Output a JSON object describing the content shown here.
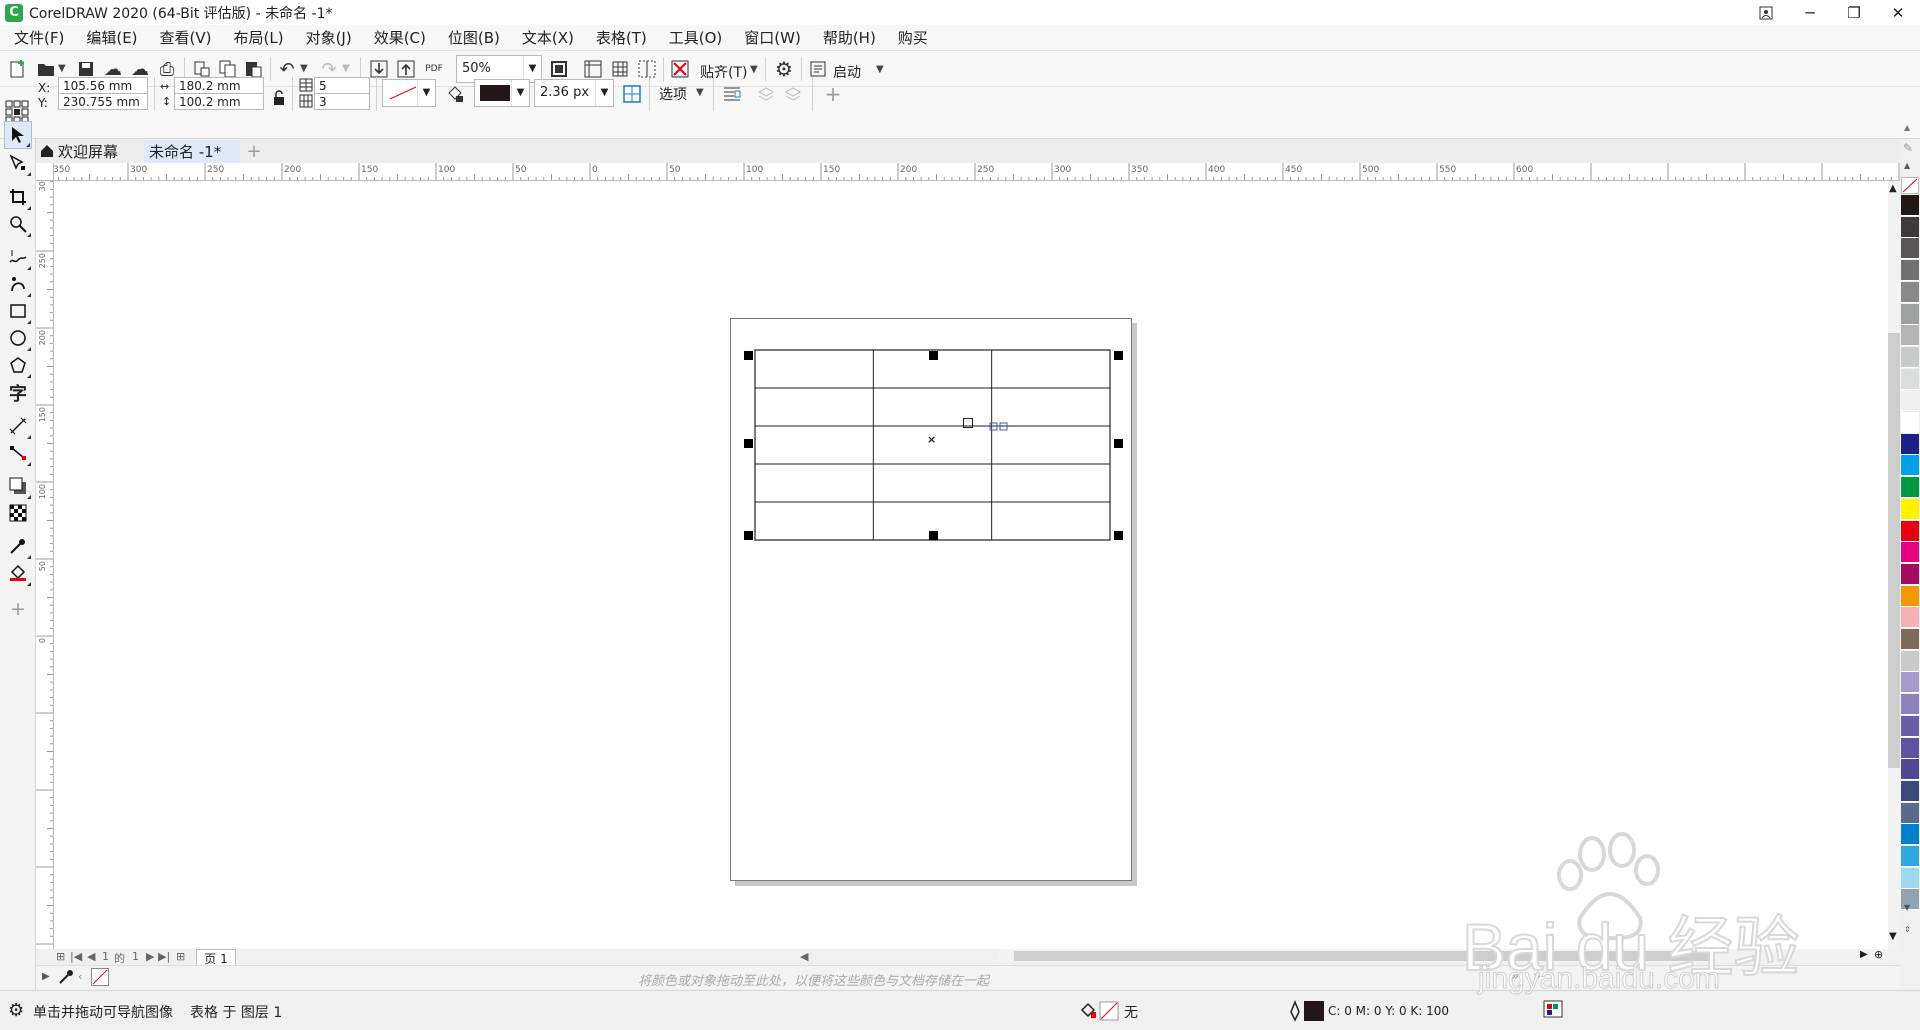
{
  "window": {
    "title": "CorelDRAW 2020 (64-Bit 评估版) - 未命名 -1*",
    "logo_letter": "C"
  },
  "menu": [
    "文件(F)",
    "编辑(E)",
    "查看(V)",
    "布局(L)",
    "对象(J)",
    "效果(C)",
    "位图(B)",
    "文本(X)",
    "表格(T)",
    "工具(O)",
    "窗口(W)",
    "帮助(H)",
    "购买"
  ],
  "toolbar": {
    "zoom_value": "50%",
    "snap_label": "贴齐(T)",
    "launch_label": "启动",
    "pdf_label": "PDF"
  },
  "property_bar": {
    "x_label": "X:",
    "y_label": "Y:",
    "x_value": "105.56 mm",
    "y_value": "230.755 mm",
    "width_value": "180.2 mm",
    "height_value": "100.2 mm",
    "rows_value": "5",
    "cols_value": "3",
    "outline_width": "2.36 px",
    "options_label": "选项"
  },
  "tabs": {
    "welcome": "欢迎屏幕",
    "document": "未命名 -1*"
  },
  "ruler": {
    "h_labels": [
      "350",
      "300",
      "250",
      "200",
      "150",
      "100",
      "50",
      "0",
      "50",
      "100",
      "150",
      "200",
      "250",
      "300",
      "350",
      "400",
      "450",
      "500",
      "550",
      "600"
    ],
    "v_labels": [
      "300",
      "250",
      "200",
      "150",
      "100",
      "50",
      "0"
    ]
  },
  "table": {
    "rows": 5,
    "cols": 3
  },
  "page_nav": {
    "current": "1",
    "of_label": "的",
    "total": "1",
    "page_tab": "页 1"
  },
  "docker_hint": "将颜色或对象拖动至此处，以便将这些颜色与文档存储在一起",
  "status": {
    "hint": "单击并拖动可导航图像",
    "selection": "表格 于 图层 1",
    "fill_label": "无",
    "cmyk": "C: 0 M: 0 Y: 0 K: 100"
  },
  "palette_colors": [
    "#231815",
    "#3e3a39",
    "#595757",
    "#727171",
    "#898989",
    "#9fa0a0",
    "#b5b5b6",
    "#c9caca",
    "#dcdddd",
    "#efefef",
    "#ffffff",
    "#1d2088",
    "#00a0e9",
    "#009944",
    "#fff100",
    "#e60012",
    "#e4007f",
    "#a40b5d",
    "#f39800",
    "#f5b2b2",
    "#7d6b5d",
    "#c9caca",
    "#a59aca",
    "#8f82bc",
    "#6a5ea8",
    "#5f52a0",
    "#4e4795",
    "#3a4a7d",
    "#5a6b8c",
    "#0081cc",
    "#2ea7e0",
    "#a0d8ef",
    "#8fa3b2"
  ],
  "watermark": {
    "brand": "Bai du 经验",
    "url": "jingyan.baidu.com"
  }
}
